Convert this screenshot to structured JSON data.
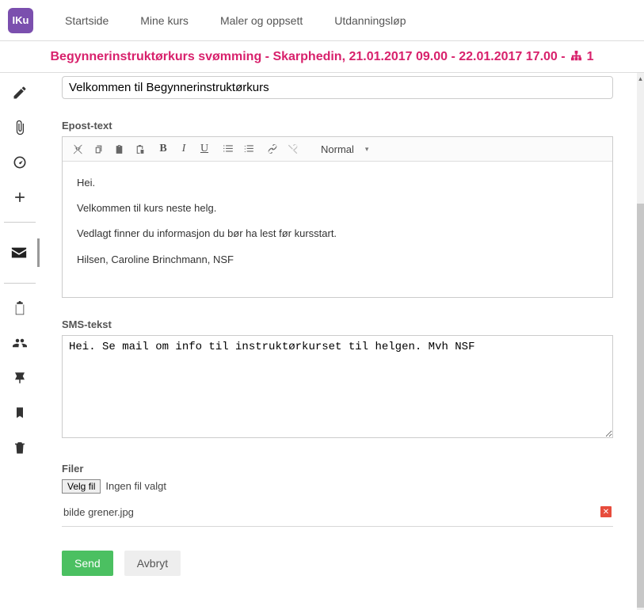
{
  "logo": "IKu",
  "topnav": [
    "Startside",
    "Mine kurs",
    "Maler og oppsett",
    "Utdanningsløp"
  ],
  "breadcrumb": {
    "text": "Begynnerinstruktørkurs svømming - Skarphedin, 21.01.2017 09.00 - 22.01.2017 17.00 -",
    "count": "1"
  },
  "subject": "Velkommen til Begynnerinstruktørkurs",
  "labels": {
    "epost": "Epost-text",
    "sms": "SMS-tekst",
    "filer": "Filer"
  },
  "toolbar_format": "Normal",
  "email_body": {
    "p1": "Hei.",
    "p2": "Velkommen til kurs neste helg.",
    "p3": "Vedlagt finner du informasjon du bør ha lest før kursstart.",
    "p4": "Hilsen, Caroline Brinchmann, NSF"
  },
  "sms_text": "Hei. Se mail om info til instruktørkurset til helgen. Mvh NSF",
  "file_picker": {
    "button": "Velg fil",
    "status": "Ingen fil valgt"
  },
  "attached_file": "bilde grener.jpg",
  "actions": {
    "send": "Send",
    "cancel": "Avbryt"
  }
}
